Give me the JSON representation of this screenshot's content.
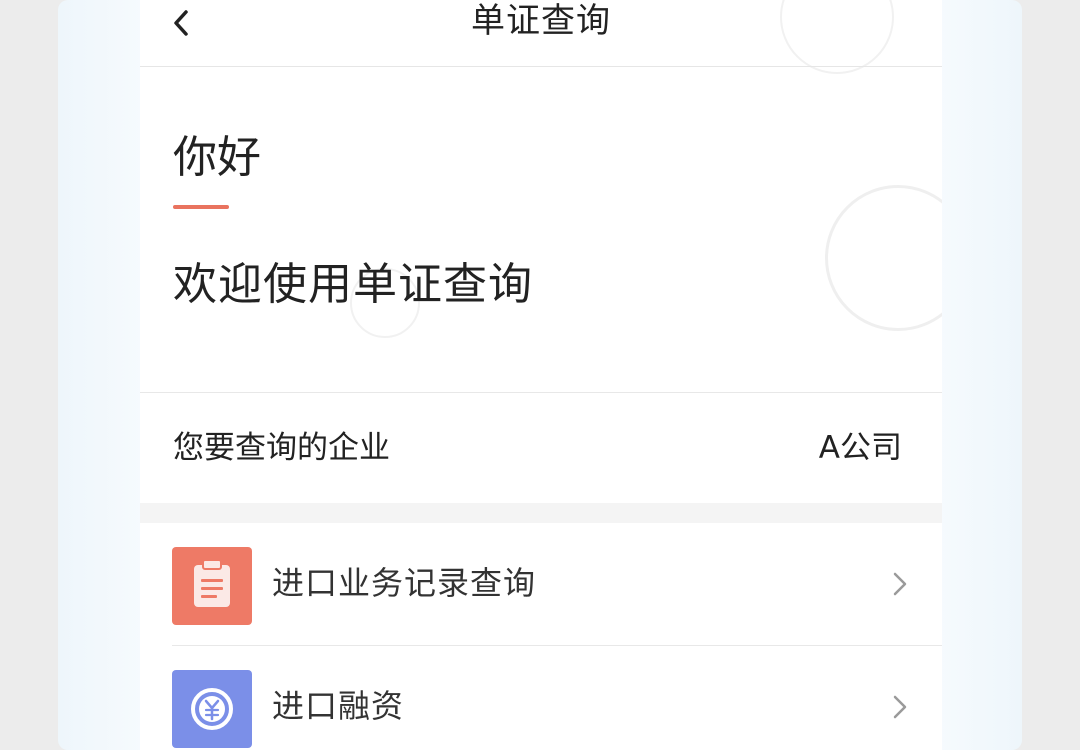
{
  "nav": {
    "title": "单证查询",
    "back_icon": "chevron-left-icon"
  },
  "greeting": {
    "hello": "你好",
    "welcome": "欢迎使用单证查询",
    "accent_color": "#e9735f"
  },
  "company": {
    "label": "您要查询的企业",
    "value": "A公司"
  },
  "menu": {
    "items": [
      {
        "label": "进口业务记录查询",
        "icon": "clipboard-icon",
        "icon_color": "#ee7a66"
      },
      {
        "label": "进口融资",
        "icon": "yen-coin-icon",
        "icon_color": "#7b8fe8"
      }
    ]
  }
}
